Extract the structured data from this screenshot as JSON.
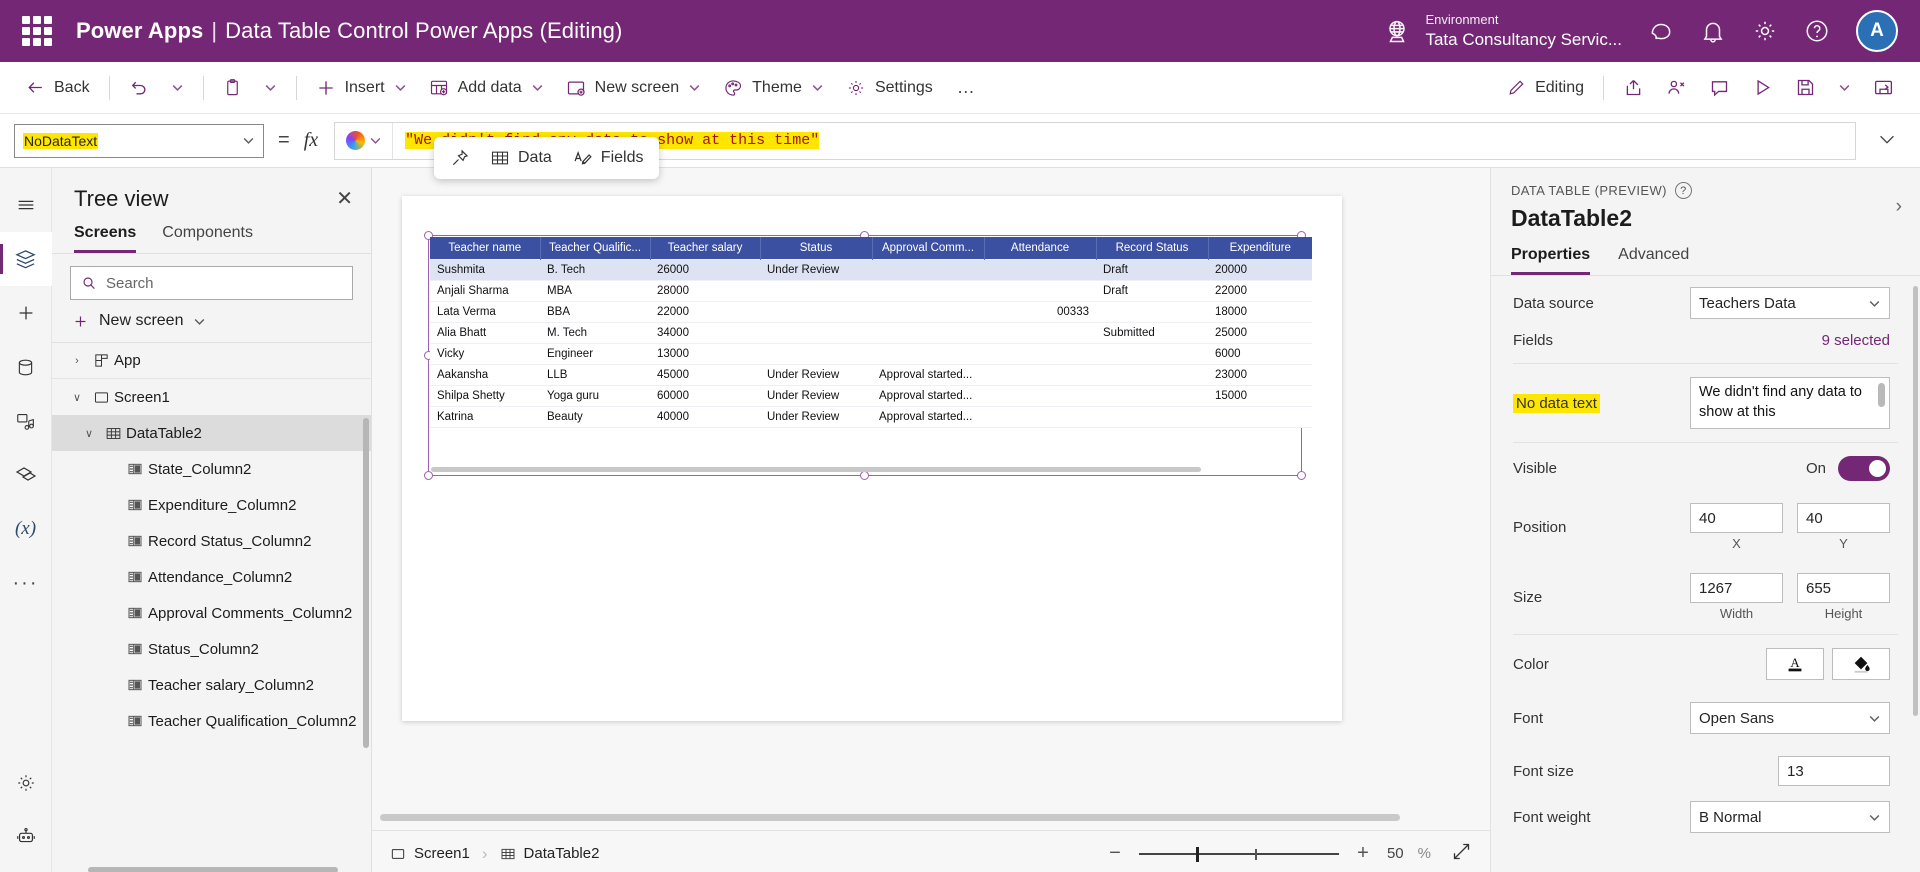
{
  "topbar": {
    "waffle_label": "App launcher",
    "product": "Power Apps",
    "separator": "|",
    "doc_title": "Data Table Control Power Apps (Editing)",
    "environment_label": "Environment",
    "environment_value": "Tata Consultancy Servic...",
    "avatar_initial": "A",
    "icons": [
      "globe-icon",
      "copilot-icon",
      "bell-icon",
      "gear-icon",
      "help-icon"
    ],
    "accent": "#742774"
  },
  "commandbar": {
    "back": "Back",
    "undo": "undo-icon",
    "paste": "paste-icon",
    "insert": "Insert",
    "add_data": "Add data",
    "new_screen": "New screen",
    "theme": "Theme",
    "settings": "Settings",
    "more": "…",
    "editing": "Editing",
    "right_icons": [
      "share-icon",
      "coauthor-icon",
      "comment-icon",
      "play-icon",
      "save-icon",
      "publish-icon"
    ]
  },
  "formulabar": {
    "property": "NoDataText",
    "equals": "=",
    "fx": "fx",
    "copilot": "copilot-icon",
    "formula": "\"We didn't find any data to show at this time\""
  },
  "rail": {
    "items": [
      {
        "name": "hamburger-icon",
        "active": false
      },
      {
        "name": "tree-view-icon",
        "active": true
      },
      {
        "name": "insert-icon",
        "active": false
      },
      {
        "name": "data-icon",
        "active": false
      },
      {
        "name": "media-icon",
        "active": false
      },
      {
        "name": "power-automate-icon",
        "active": false
      },
      {
        "name": "variables-icon",
        "active": false
      },
      {
        "name": "more-icon",
        "active": false
      },
      {
        "name": "settings-icon",
        "active": false
      },
      {
        "name": "copilot-studio-icon",
        "active": false
      }
    ]
  },
  "treeview": {
    "title": "Tree view",
    "close": "✕",
    "tabs": [
      {
        "label": "Screens",
        "selected": true
      },
      {
        "label": "Components",
        "selected": false
      }
    ],
    "search_placeholder": "Search",
    "new_screen": "New screen",
    "nodes": [
      {
        "label": "App",
        "level": 0,
        "twist": "›",
        "icon": "app-icon",
        "selected": false
      },
      {
        "label": "Screen1",
        "level": 0,
        "twist": "∨",
        "icon": "screen-icon",
        "selected": false
      },
      {
        "label": "DataTable2",
        "level": 1,
        "twist": "∨",
        "icon": "datatable-icon",
        "selected": true
      },
      {
        "label": "State_Column2",
        "level": 2,
        "twist": "",
        "icon": "column-icon",
        "selected": false
      },
      {
        "label": "Expenditure_Column2",
        "level": 2,
        "twist": "",
        "icon": "column-icon",
        "selected": false
      },
      {
        "label": "Record Status_Column2",
        "level": 2,
        "twist": "",
        "icon": "column-icon",
        "selected": false
      },
      {
        "label": "Attendance_Column2",
        "level": 2,
        "twist": "",
        "icon": "column-icon",
        "selected": false
      },
      {
        "label": "Approval Comments_Column2",
        "level": 2,
        "twist": "",
        "icon": "column-icon",
        "selected": false
      },
      {
        "label": "Status_Column2",
        "level": 2,
        "twist": "",
        "icon": "column-icon",
        "selected": false
      },
      {
        "label": "Teacher salary_Column2",
        "level": 2,
        "twist": "",
        "icon": "column-icon",
        "selected": false
      },
      {
        "label": "Teacher Qualification_Column2",
        "level": 2,
        "twist": "",
        "icon": "column-icon",
        "selected": false
      }
    ]
  },
  "canvas": {
    "mini_toolbar": [
      {
        "label": "",
        "icon": "pin-icon"
      },
      {
        "label": "Data",
        "icon": "table-icon"
      },
      {
        "label": "Fields",
        "icon": "fields-icon"
      }
    ],
    "table": {
      "columns": [
        "Teacher name",
        "Teacher Qualific...",
        "Teacher salary",
        "Status",
        "Approval Comm...",
        "Attendance",
        "Record Status",
        "Expenditure"
      ],
      "rows": [
        [
          "Sushmita",
          "B. Tech",
          "26000",
          "Under Review",
          "",
          "",
          "Draft",
          "20000"
        ],
        [
          "Anjali Sharma",
          "MBA",
          "28000",
          "",
          "",
          "",
          "Draft",
          "22000"
        ],
        [
          "Lata Verma",
          "BBA",
          "22000",
          "",
          "",
          "00333",
          "",
          "18000"
        ],
        [
          "Alia Bhatt",
          "M. Tech",
          "34000",
          "",
          "",
          "",
          "Submitted",
          "25000"
        ],
        [
          "Vicky",
          "Engineer",
          "13000",
          "",
          "",
          "",
          "",
          "6000"
        ],
        [
          "Aakansha",
          "LLB",
          "45000",
          "Under Review",
          "Approval started...",
          "",
          "",
          "23000"
        ],
        [
          "Shilpa Shetty",
          "Yoga guru",
          "60000",
          "Under Review",
          "Approval started...",
          "",
          "",
          "15000"
        ],
        [
          "Katrina",
          "Beauty",
          "40000",
          "Under Review",
          "Approval started...",
          "",
          "",
          ""
        ]
      ],
      "selected_row_index": 0,
      "header_bg": "#3b50a0"
    }
  },
  "statusbar": {
    "breadcrumb": [
      {
        "label": "Screen1",
        "icon": "screen-icon"
      },
      {
        "label": "DataTable2",
        "icon": "datatable-icon"
      }
    ],
    "zoom_out": "−",
    "zoom_in": "+",
    "zoom_value": "50",
    "zoom_unit": "%",
    "fit_icon": "fit-screen-icon"
  },
  "properties": {
    "kicker": "DATA TABLE (PREVIEW)",
    "help": "?",
    "collapse": "›",
    "control_name": "DataTable2",
    "tabs": [
      {
        "label": "Properties",
        "selected": true
      },
      {
        "label": "Advanced",
        "selected": false
      }
    ],
    "data_source_label": "Data source",
    "data_source_value": "Teachers Data",
    "fields_label": "Fields",
    "fields_value": "9 selected",
    "no_data_text_label": "No data text",
    "no_data_text_value": "We didn't find any data to show at this",
    "visible_label": "Visible",
    "visible_state": "On",
    "position_label": "Position",
    "position_x": "40",
    "position_y": "40",
    "position_x_caption": "X",
    "position_y_caption": "Y",
    "size_label": "Size",
    "size_width": "1267",
    "size_height": "655",
    "size_width_caption": "Width",
    "size_height_caption": "Height",
    "color_label": "Color",
    "color_text_icon": "font-color-icon",
    "color_fill_icon": "fill-color-icon",
    "font_label": "Font",
    "font_value": "Open Sans",
    "font_size_label": "Font size",
    "font_size_value": "13",
    "font_weight_label": "Font weight",
    "font_weight_value": "B  Normal"
  }
}
